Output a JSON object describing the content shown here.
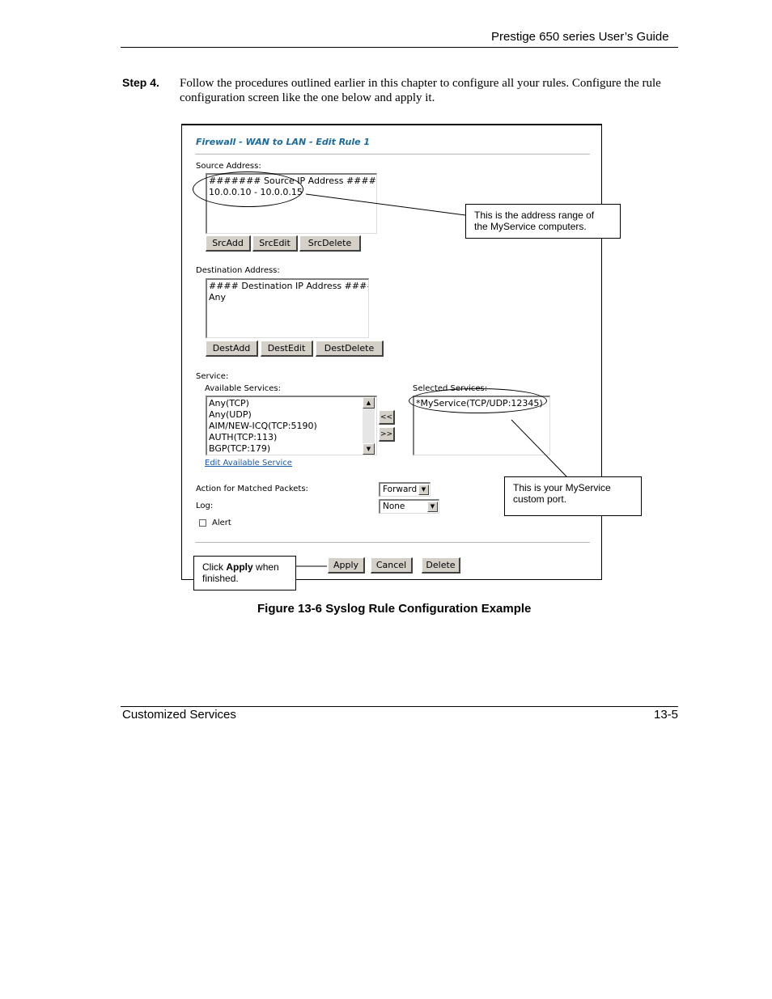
{
  "header": {
    "title": "Prestige 650 series User’s Guide"
  },
  "step": {
    "label": "Step 4.",
    "text": "Follow the procedures outlined earlier in this chapter to configure all your rules. Configure the rule configuration screen like the one below and apply it."
  },
  "screen": {
    "title": "Firewall - WAN to LAN - Edit Rule 1",
    "source": {
      "label": "Source Address:",
      "items": [
        "####### Source IP Address #######",
        "10.0.0.10 - 10.0.0.15"
      ],
      "buttons": {
        "add": "SrcAdd",
        "edit": "SrcEdit",
        "delete": "SrcDelete"
      }
    },
    "destination": {
      "label": "Destination Address:",
      "items": [
        "#### Destination IP Address #####",
        "Any"
      ],
      "buttons": {
        "add": "DestAdd",
        "edit": "DestEdit",
        "delete": "DestDelete"
      }
    },
    "service": {
      "label": "Service:",
      "available_label": "Available Services:",
      "available_items": [
        "Any(TCP)",
        "Any(UDP)",
        "AIM/NEW-ICQ(TCP:5190)",
        "AUTH(TCP:113)",
        "BGP(TCP:179)"
      ],
      "selected_label": "Selected Services:",
      "selected_items": [
        "*MyService(TCP/UDP:12345)"
      ],
      "move_left": "<<",
      "move_right": ">>",
      "edit_link": "Edit Available Service"
    },
    "action": {
      "label": "Action for Matched Packets:",
      "value": "Forward"
    },
    "log": {
      "label": "Log:",
      "value": "None"
    },
    "alert": {
      "label": "Alert",
      "checked": false
    },
    "buttons": {
      "apply": "Apply",
      "cancel": "Cancel",
      "delete": "Delete"
    }
  },
  "callouts": {
    "address": {
      "line1": "This is the address range of",
      "line2": "the MyService computers."
    },
    "port": {
      "line1": "This is your MyService",
      "line2": "custom port."
    },
    "apply": {
      "pre": "Click ",
      "bold": "Apply",
      "post": " when",
      "line2": "finished."
    }
  },
  "caption": "Figure 13-6 Syslog Rule Configuration Example",
  "footer": {
    "left": "Customized Services",
    "right": "13-5"
  }
}
